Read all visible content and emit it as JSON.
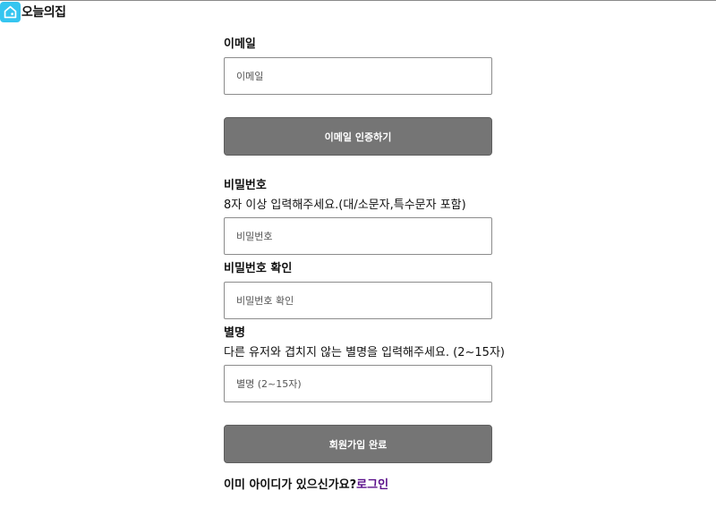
{
  "header": {
    "logo_text": "오늘의집",
    "logo_icon": "house-icon",
    "brand_color": "#35c5f0"
  },
  "form": {
    "email": {
      "label": "이메일",
      "placeholder": "이메일"
    },
    "verify_button": "이메일 인증하기",
    "password": {
      "label": "비밀번호",
      "hint": "8자 이상 입력해주세요.(대/소문자,특수문자 포함)",
      "placeholder": "비밀번호"
    },
    "password_confirm": {
      "label": "비밀번호 확인",
      "placeholder": "비밀번호 확인"
    },
    "nickname": {
      "label": "별명",
      "hint": "다른 유저와 겹치지 않는 별명을 입력해주세요. (2~15자)",
      "placeholder": "별명 (2~15자)"
    },
    "submit_button": "회원가입 완료"
  },
  "footer": {
    "question": "이미 아이디가 있으신가요?",
    "login_link": "로그인",
    "link_color": "#5a0f8a"
  },
  "colors": {
    "button_bg": "#757575",
    "input_border": "#8c8c8c"
  }
}
